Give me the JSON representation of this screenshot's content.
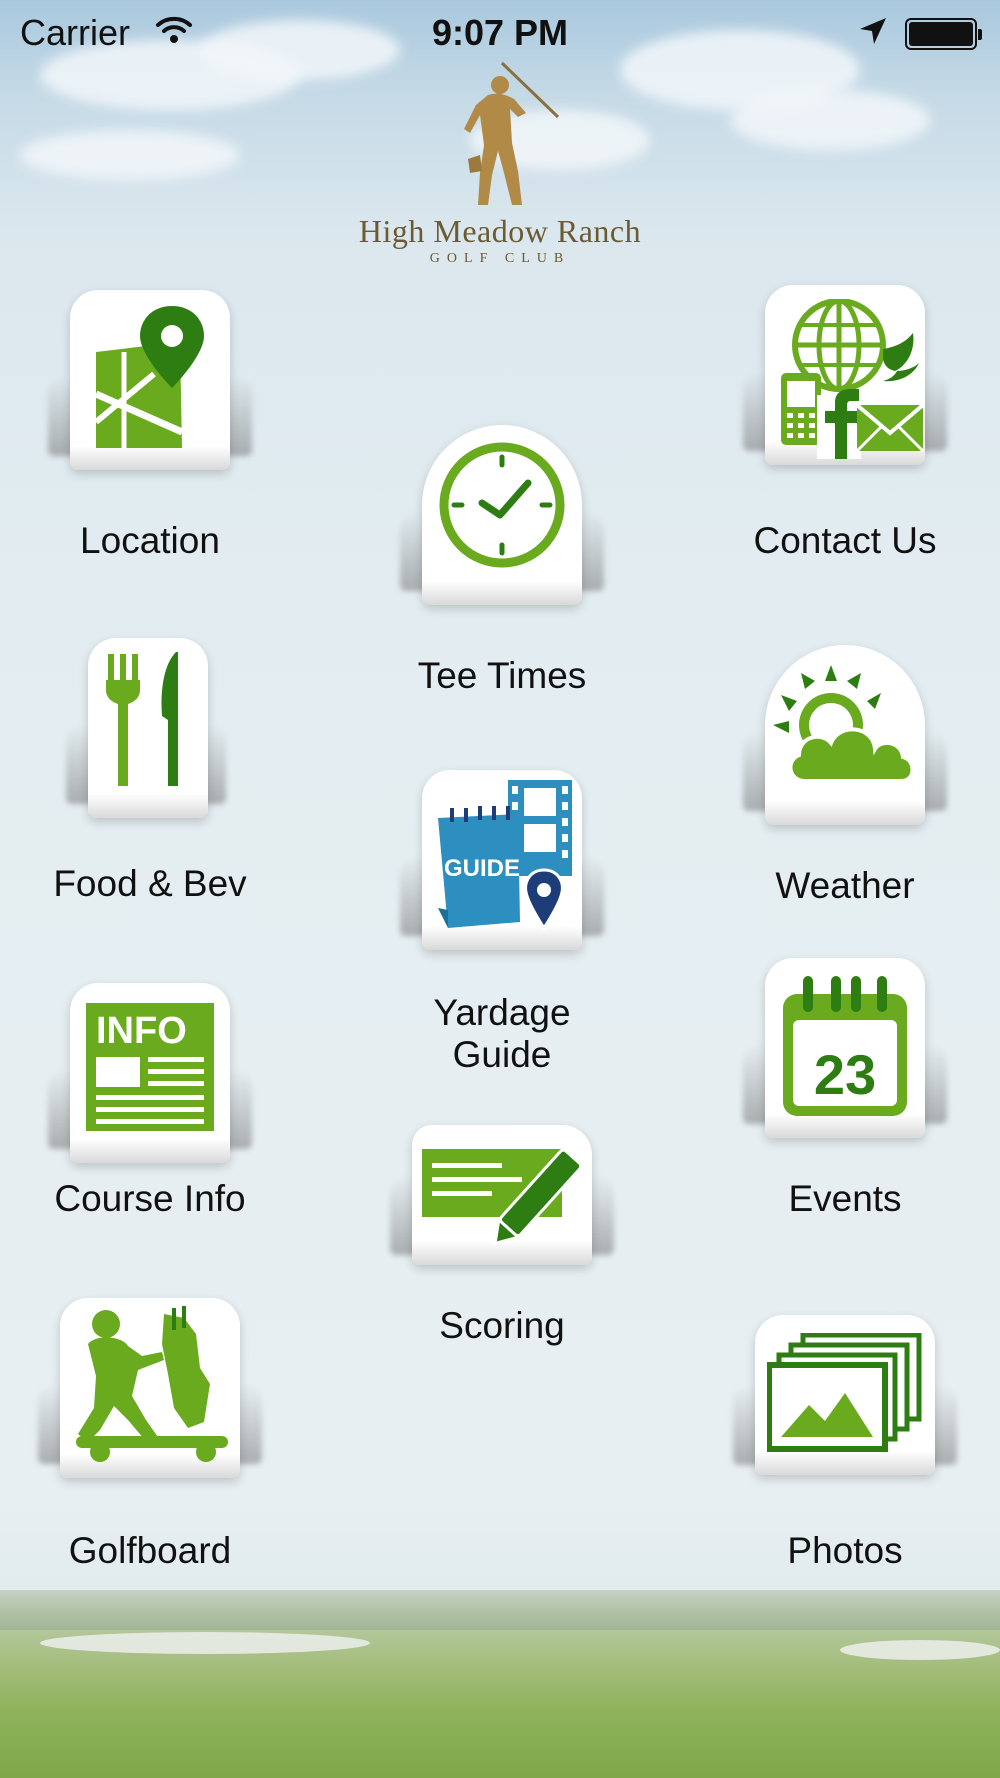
{
  "status_bar": {
    "carrier": "Carrier",
    "time": "9:07 PM"
  },
  "logo": {
    "title": "High Meadow Ranch",
    "subtitle": "GOLF CLUB"
  },
  "menu": {
    "location": "Location",
    "contact": "Contact Us",
    "tee_times": "Tee Times",
    "food": "Food & Bev",
    "weather": "Weather",
    "yardage": "Yardage Guide",
    "course_info": "Course Info",
    "events": "Events",
    "scoring": "Scoring",
    "golfboard": "Golfboard",
    "photos": "Photos"
  },
  "icon_text": {
    "guide": "GUIDE",
    "info": "INFO",
    "calendar_day": "23"
  },
  "colors": {
    "green": "#6aaa1e",
    "dark_green": "#2e7d12",
    "blue": "#2c8fc0",
    "navy": "#1c3d78",
    "gold": "#b08a46"
  }
}
